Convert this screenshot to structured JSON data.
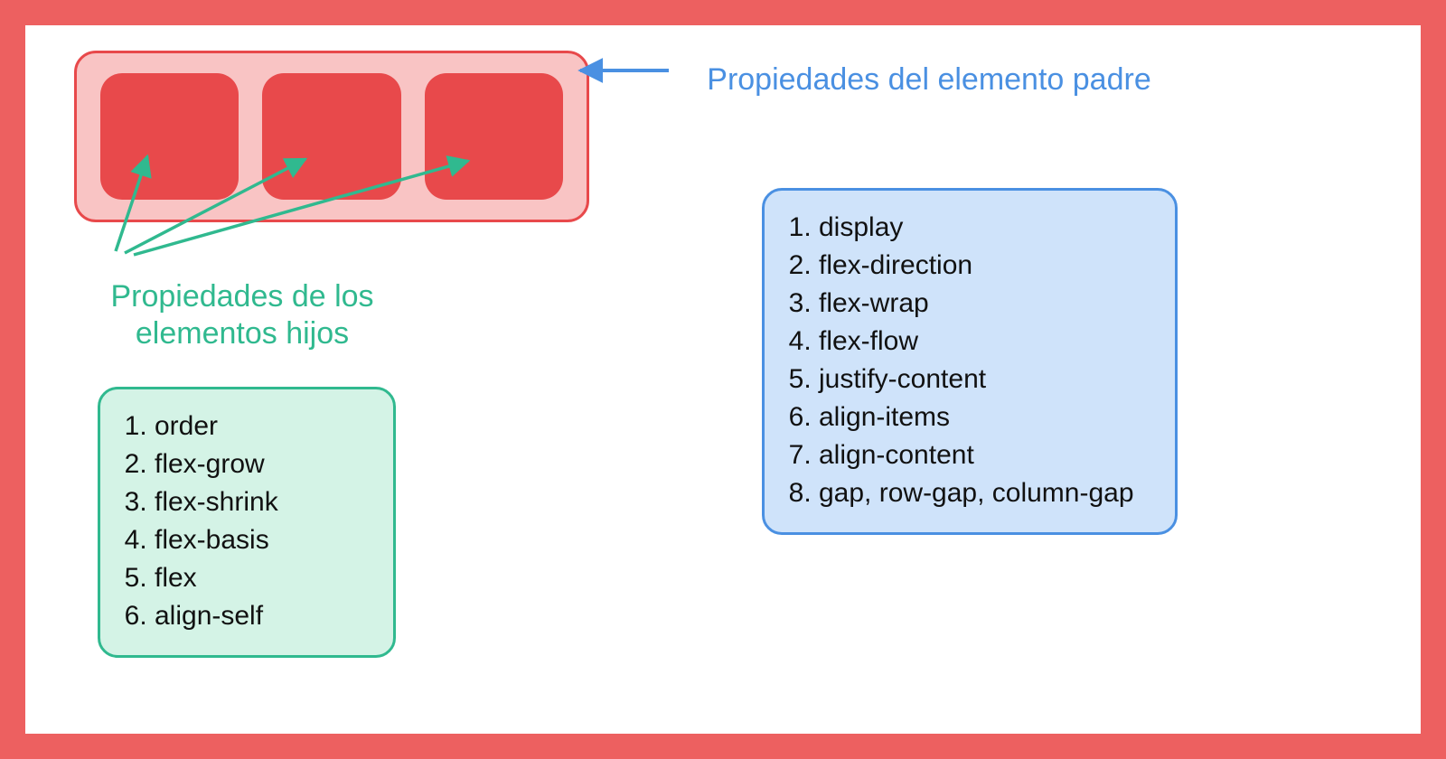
{
  "labels": {
    "parent": "Propiedades del elemento padre",
    "children": "Propiedades de los elementos hijos"
  },
  "parent_properties": [
    "display",
    "flex-direction",
    "flex-wrap",
    "flex-flow",
    "justify-content",
    "align-items",
    "align-content",
    "gap, row-gap, column-gap"
  ],
  "child_properties": [
    "order",
    "flex-grow",
    "flex-shrink",
    "flex-basis",
    "flex",
    "align-self"
  ],
  "colors": {
    "frame": "#ed6060",
    "parent_bg": "#f9c4c4",
    "parent_border": "#e8494b",
    "child_bg": "#e8494b",
    "blue": "#4a90e2",
    "green": "#30b98f",
    "box_blue_bg": "#cfe3fa",
    "box_green_bg": "#d4f3e6"
  }
}
